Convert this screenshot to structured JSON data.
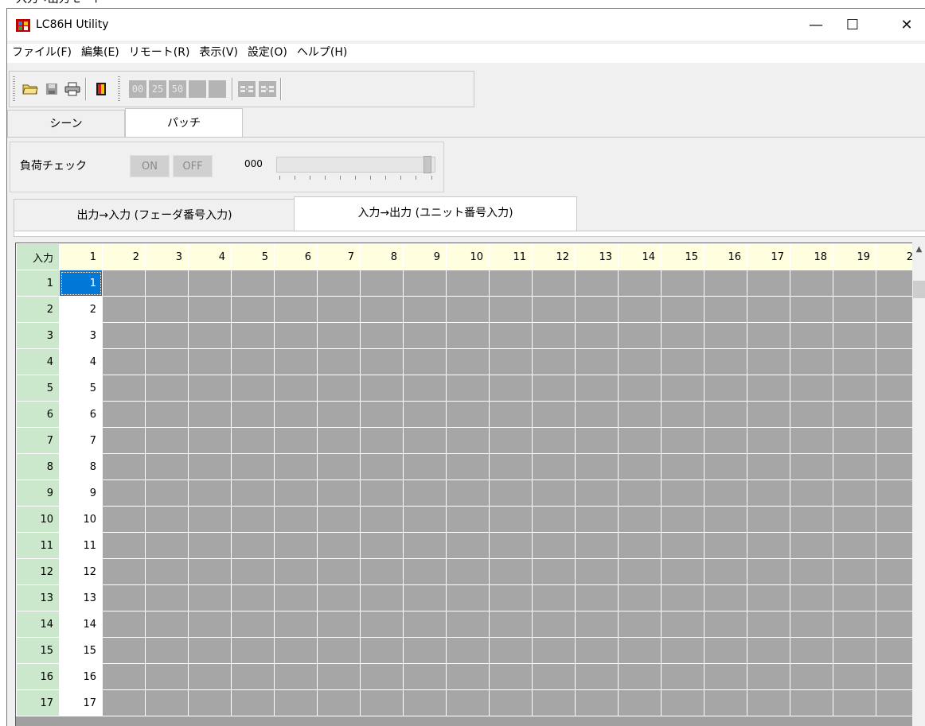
{
  "caption": "入力→出力モード",
  "window": {
    "title": "LC86H Utility",
    "minimize": "—",
    "maximize": "☐",
    "close": "✕"
  },
  "menu": [
    "ファイル(F)",
    "編集(E)",
    "リモート(R)",
    "表示(V)",
    "設定(O)",
    "ヘルプ(H)"
  ],
  "toolbar": {
    "icons": [
      "open-folder",
      "save-disk",
      "print",
      "exit-door"
    ],
    "level_buttons": [
      "00",
      "25",
      "50"
    ]
  },
  "main_tabs": [
    {
      "label": "シーン",
      "active": false
    },
    {
      "label": "パッチ",
      "active": true
    }
  ],
  "load_check": {
    "label": "負荷チェック",
    "on": "ON",
    "off": "OFF",
    "value": "000"
  },
  "patch_tabs": [
    {
      "label": "出力→入力 (フェーダ番号入力)",
      "active": false
    },
    {
      "label": "入力→出力 (ユニット番号入力)",
      "active": true
    }
  ],
  "grid": {
    "corner": "入力",
    "columns": [
      "1",
      "2",
      "3",
      "4",
      "5",
      "6",
      "7",
      "8",
      "9",
      "10",
      "11",
      "12",
      "13",
      "14",
      "15",
      "16",
      "17",
      "18",
      "19",
      "2"
    ],
    "rows": [
      {
        "input": "1",
        "output": "1"
      },
      {
        "input": "2",
        "output": "2"
      },
      {
        "input": "3",
        "output": "3"
      },
      {
        "input": "4",
        "output": "4"
      },
      {
        "input": "5",
        "output": "5"
      },
      {
        "input": "6",
        "output": "6"
      },
      {
        "input": "7",
        "output": "7"
      },
      {
        "input": "8",
        "output": "8"
      },
      {
        "input": "9",
        "output": "9"
      },
      {
        "input": "10",
        "output": "10"
      },
      {
        "input": "11",
        "output": "11"
      },
      {
        "input": "12",
        "output": "12"
      },
      {
        "input": "13",
        "output": "13"
      },
      {
        "input": "14",
        "output": "14"
      },
      {
        "input": "15",
        "output": "15"
      },
      {
        "input": "16",
        "output": "16"
      },
      {
        "input": "17",
        "output": "17"
      }
    ],
    "selected_row": 0
  }
}
